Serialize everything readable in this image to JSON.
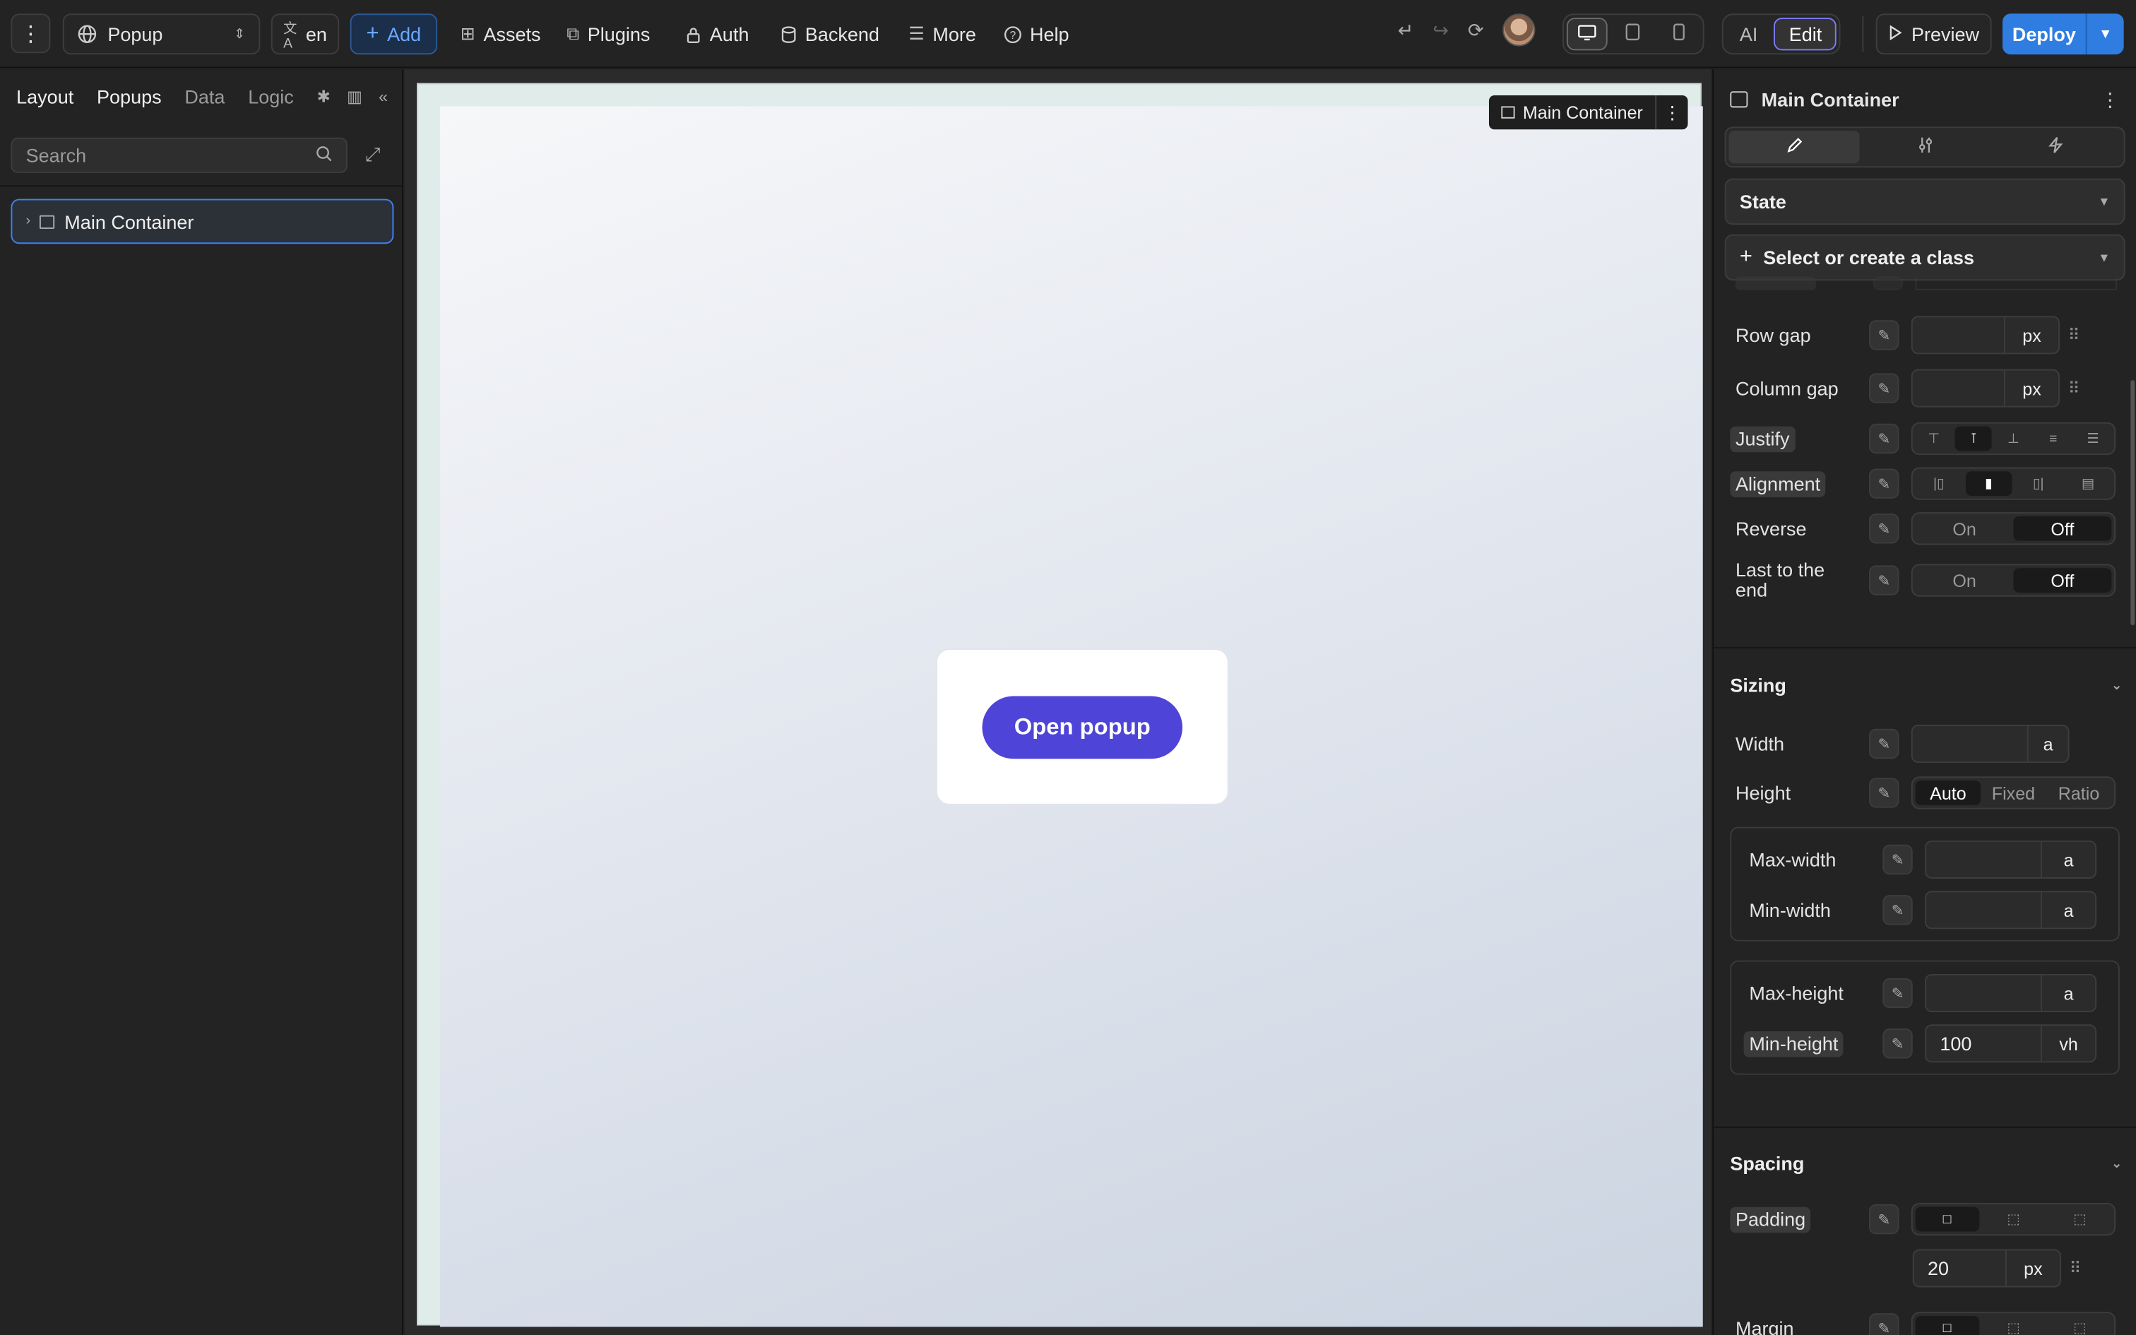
{
  "topbar": {
    "page_name": "Popup",
    "lang": "en",
    "add": "Add",
    "nav": [
      "Assets",
      "Plugins",
      "Auth",
      "Backend",
      "More",
      "Help"
    ],
    "mode": {
      "ai": "AI",
      "edit": "Edit"
    },
    "preview": "Preview",
    "deploy": "Deploy"
  },
  "leftpanel": {
    "tabs": [
      "Layout",
      "Popups",
      "Data",
      "Logic"
    ],
    "active_tab": "Popups",
    "search_placeholder": "Search",
    "tree": [
      {
        "label": "Main Container"
      }
    ]
  },
  "canvas": {
    "selected_label": "Main Container",
    "popup_button": "Open popup",
    "button_color": "#4e44d7"
  },
  "rightpanel": {
    "title": "Main Container",
    "state_label": "State",
    "class_label": "Select or create a class",
    "layout": {
      "row_gap": {
        "label": "Row gap",
        "unit": "px"
      },
      "column_gap": {
        "label": "Column gap",
        "unit": "px"
      },
      "justify": {
        "label": "Justify"
      },
      "alignment": {
        "label": "Alignment"
      },
      "reverse": {
        "label": "Reverse",
        "on": "On",
        "off": "Off"
      },
      "last_to_end": {
        "label": "Last to the end",
        "on": "On",
        "off": "Off"
      }
    },
    "sizing": {
      "title": "Sizing",
      "width": {
        "label": "Width",
        "unit": "a"
      },
      "height": {
        "label": "Height",
        "options": [
          "Auto",
          "Fixed",
          "Ratio"
        ],
        "selected": "Auto"
      },
      "max_width": {
        "label": "Max-width",
        "unit": "a"
      },
      "min_width": {
        "label": "Min-width",
        "unit": "a"
      },
      "max_height": {
        "label": "Max-height",
        "unit": "a"
      },
      "min_height": {
        "label": "Min-height",
        "value": "100",
        "unit": "vh"
      }
    },
    "spacing": {
      "title": "Spacing",
      "padding": {
        "label": "Padding",
        "value": "20",
        "unit": "px"
      },
      "margin": {
        "label": "Margin"
      }
    }
  }
}
